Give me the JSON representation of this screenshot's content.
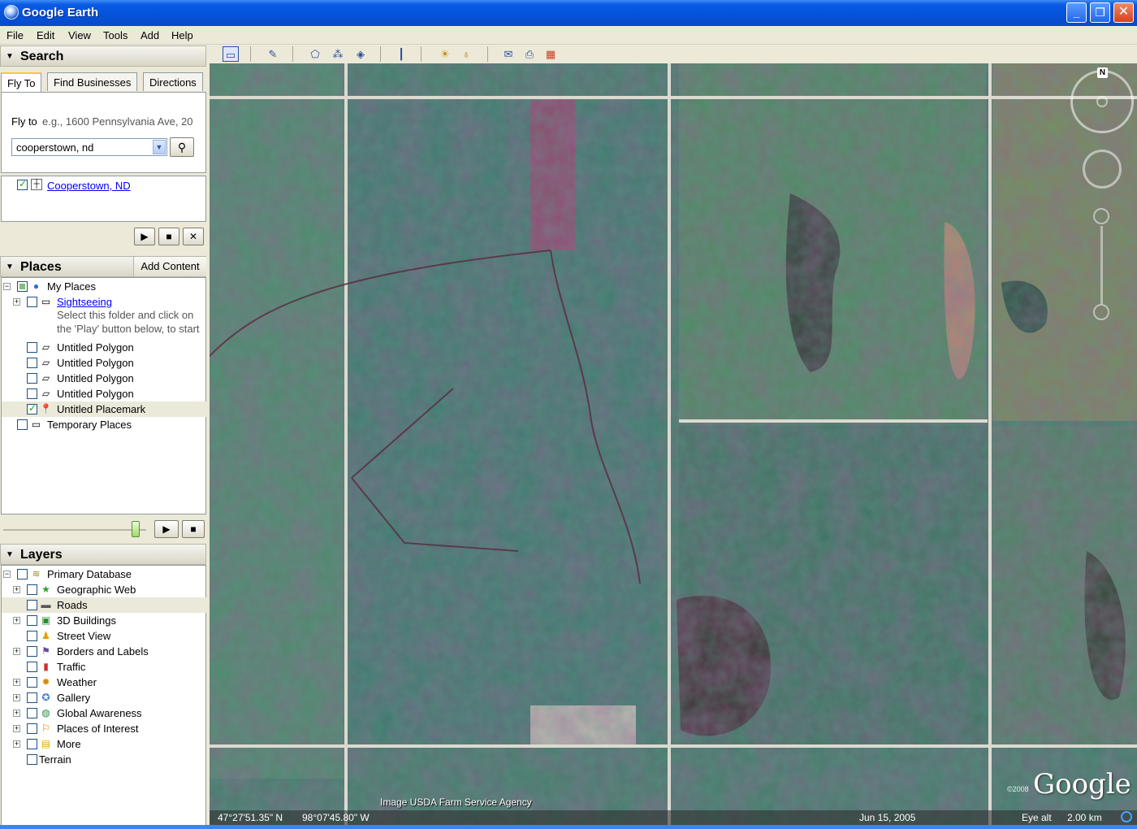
{
  "window": {
    "title": "Google Earth",
    "min_glyph": "_",
    "max_glyph": "❐",
    "close_glyph": "✕"
  },
  "menu": [
    "File",
    "Edit",
    "View",
    "Tools",
    "Add",
    "Help"
  ],
  "toolbar_icons": [
    "sidebar-toggle-icon",
    "placemark-icon",
    "polygon-icon",
    "path-icon",
    "image-overlay-icon",
    "ruler-icon",
    "sunlight-icon",
    "planet-icon",
    "email-icon",
    "print-icon",
    "maps-icon"
  ],
  "search": {
    "header": "Search",
    "tabs": [
      "Fly To",
      "Find Businesses",
      "Directions"
    ],
    "fly_to_label": "Fly to",
    "fly_to_hint": "e.g., 1600 Pennsylvania Ave, 20",
    "query": "cooperstown, nd",
    "result": "Cooperstown, ND"
  },
  "places": {
    "header": "Places",
    "add_content": "Add Content",
    "my_places": "My Places",
    "sightseeing": "Sightseeing",
    "sightseeing_desc_1": "Select this folder and click on",
    "sightseeing_desc_2": "the 'Play' button below, to start",
    "items": [
      "Untitled Polygon",
      "Untitled Polygon",
      "Untitled Polygon",
      "Untitled Polygon",
      "Untitled Placemark"
    ],
    "temporary": "Temporary Places",
    "tour_level": 0.95
  },
  "layers": {
    "header": "Layers",
    "root": "Primary Database",
    "items": [
      "Geographic Web",
      "Roads",
      "3D Buildings",
      "Street View",
      "Borders and Labels",
      "Traffic",
      "Weather",
      "Gallery",
      "Global Awareness",
      "Places of Interest",
      "More"
    ],
    "terrain": "Terrain"
  },
  "map": {
    "compass_north": "N",
    "credit": "Image USDA Farm Service Agency",
    "copyright": "©2008",
    "logo": "Google",
    "lat": "47°27'51.35\" N",
    "lon": "98°07'45.80\" W",
    "date": "Jun 15, 2005",
    "eye_alt_label": "Eye alt",
    "eye_alt_value": "2.00 km"
  }
}
